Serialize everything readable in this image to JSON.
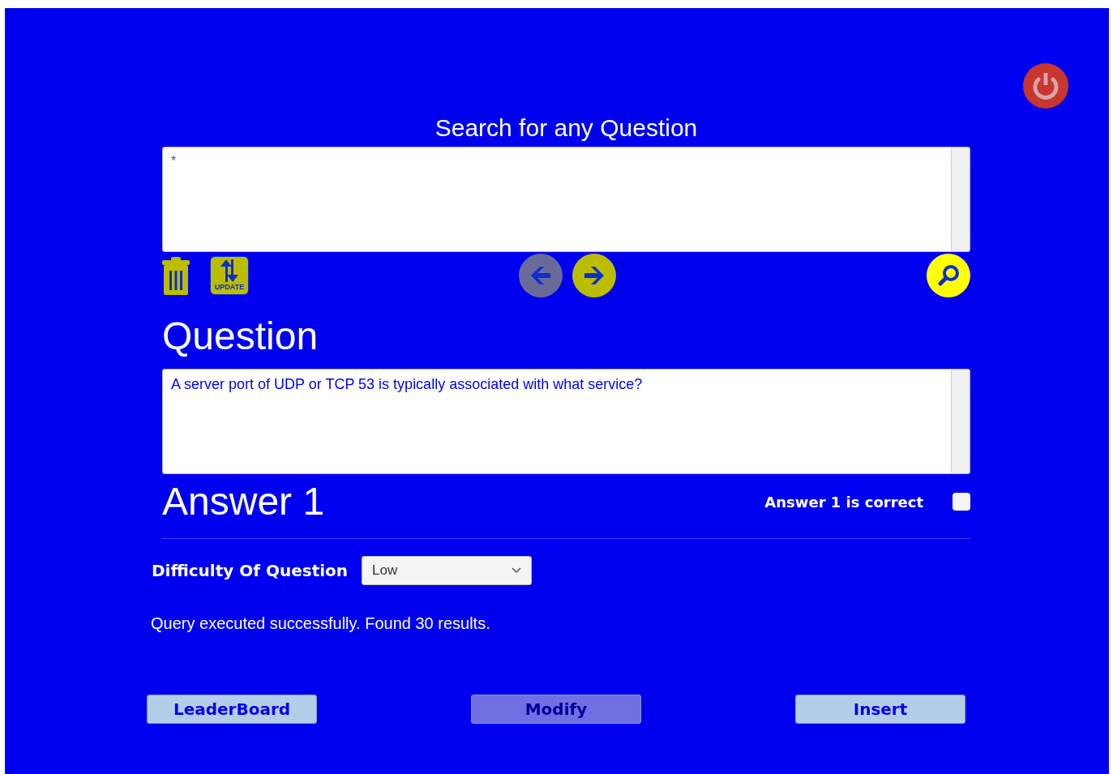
{
  "search": {
    "title": "Search for any Question",
    "value": "*"
  },
  "toolbar": {
    "update_label": "UPDATE",
    "previous_disabled": true,
    "next_disabled": false
  },
  "question": {
    "heading": "Question",
    "value": "A server port of UDP or TCP 53 is typically associated with what service?"
  },
  "answer": {
    "heading": "Answer 1",
    "correct_label": "Answer 1 is correct",
    "checked": false
  },
  "difficulty": {
    "label": "Difficulty Of Question",
    "value": "Low"
  },
  "status": "Query executed successfully. Found 30 results.",
  "buttons": [
    {
      "label": "LeaderBoard",
      "disabled": false
    },
    {
      "label": "Modify",
      "disabled": true
    },
    {
      "label": "Insert",
      "disabled": false
    }
  ]
}
